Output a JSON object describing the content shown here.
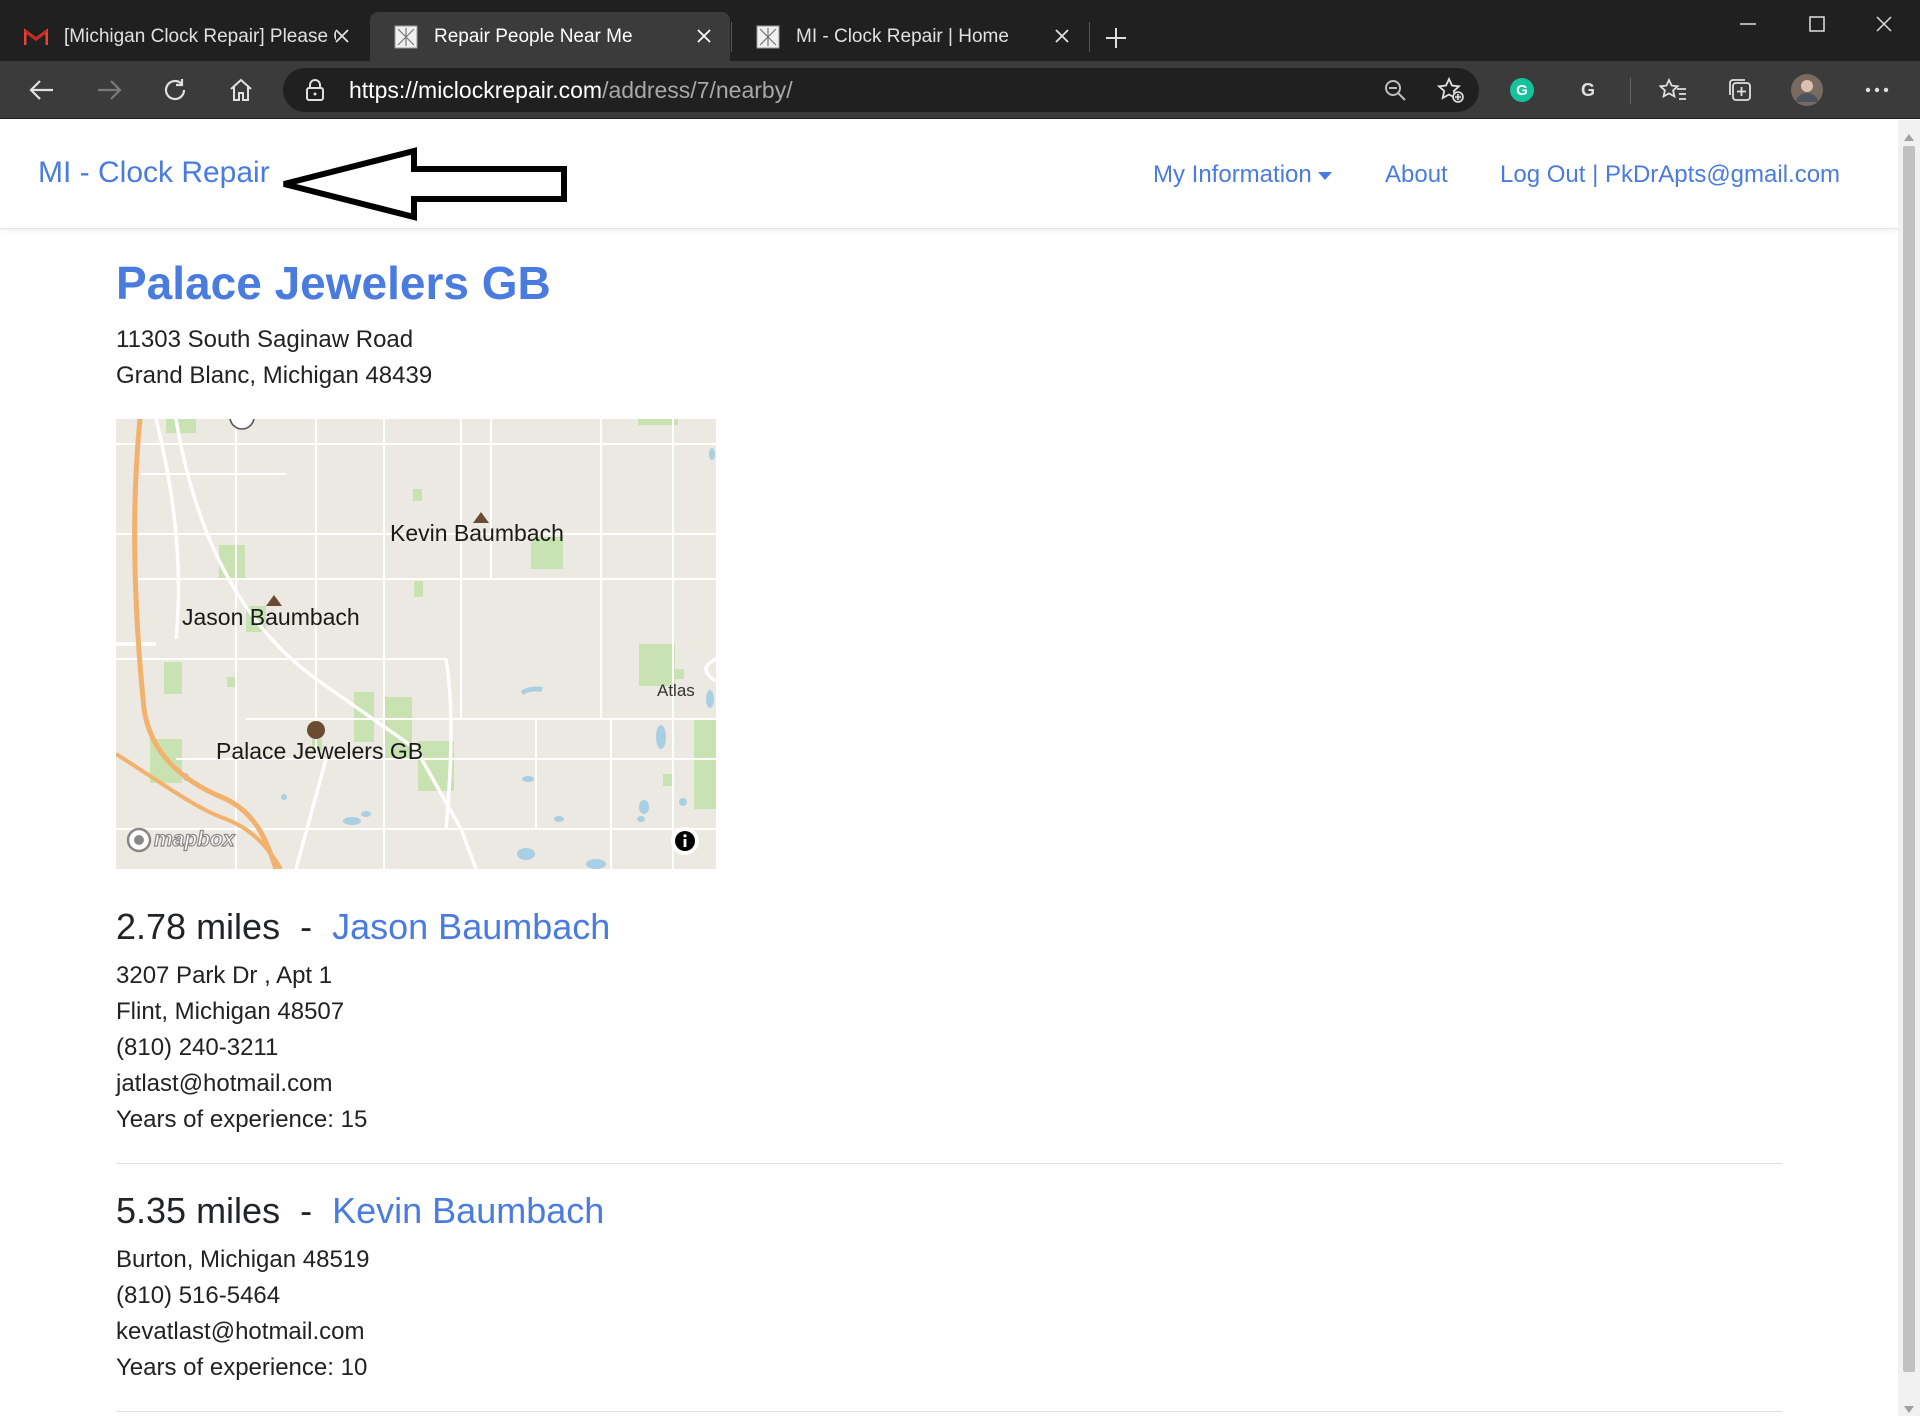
{
  "browser": {
    "tabs": [
      {
        "title": "[Michigan Clock Repair] Please C",
        "favicon": "gmail-icon",
        "active": false
      },
      {
        "title": "Repair People Near Me",
        "favicon": "site-icon",
        "active": true
      },
      {
        "title": "MI - Clock Repair | Home",
        "favicon": "site-icon",
        "active": false
      }
    ],
    "url_host": "https://miclockrepair.com",
    "url_path": "/address/7/nearby/"
  },
  "navbar": {
    "brand": "MI - Clock Repair",
    "my_information": "My Information",
    "about": "About",
    "logout": "Log Out | PkDrApts@gmail.com"
  },
  "shop": {
    "name": "Palace Jewelers GB",
    "street": "11303 South Saginaw Road",
    "city_line": "Grand Blanc, Michigan 48439"
  },
  "map": {
    "labels": {
      "kevin": "Kevin Baumbach",
      "jason": "Jason Baumbach",
      "palace": "Palace Jewelers GB",
      "atlas": "Atlas"
    },
    "attribution": "mapbox"
  },
  "repair_people": [
    {
      "distance": "2.78 miles",
      "name": "Jason Baumbach",
      "street": "3207 Park Dr , Apt 1",
      "city_line": "Flint, Michigan 48507",
      "phone": "(810) 240-3211",
      "email": "jatlast@hotmail.com",
      "experience": "Years of experience: 15"
    },
    {
      "distance": "5.35 miles",
      "name": "Kevin Baumbach",
      "city_line": "Burton, Michigan 48519",
      "phone": "(810) 516-5464",
      "email": "kevatlast@hotmail.com",
      "experience": "Years of experience: 10"
    }
  ],
  "colors": {
    "link": "#4a7bdf",
    "chrome_dark": "#202020",
    "chrome_mid": "#3b3b3b"
  }
}
